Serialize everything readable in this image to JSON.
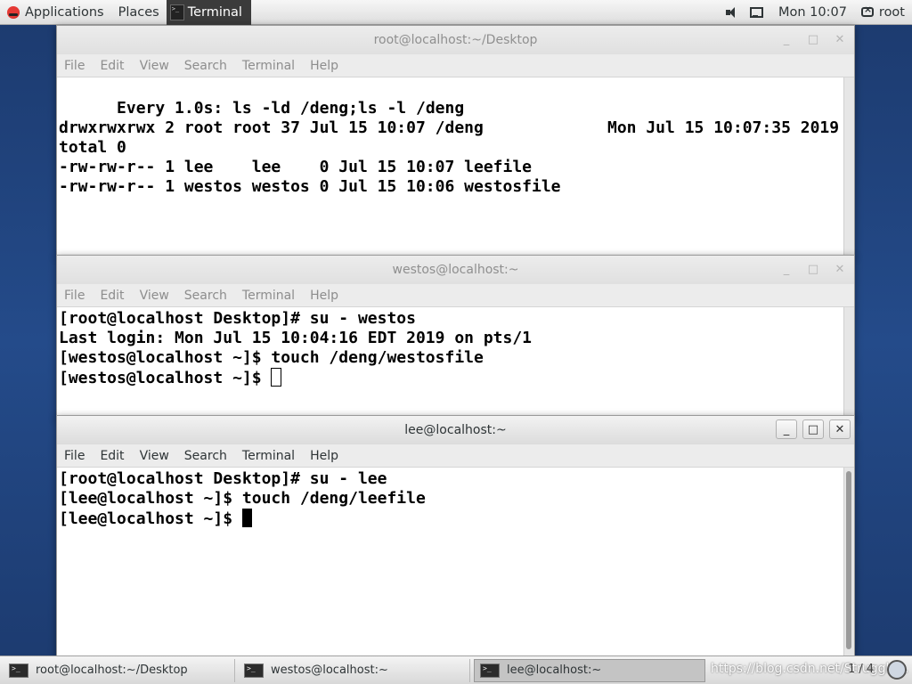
{
  "top_panel": {
    "applications": "Applications",
    "places": "Places",
    "terminal": "Terminal",
    "clock": "Mon 10:07",
    "user": "root"
  },
  "menu": [
    "File",
    "Edit",
    "View",
    "Search",
    "Terminal",
    "Help"
  ],
  "windows": {
    "root": {
      "title": "root@localhost:~/Desktop",
      "watch_header": "Every 1.0s: ls -ld /deng;ls -l /deng",
      "watch_time": "Mon Jul 15 10:07:35 2019",
      "lines": [
        "",
        "drwxrwxrwx 2 root root 37 Jul 15 10:07 /deng",
        "total 0",
        "-rw-rw-r-- 1 lee    lee    0 Jul 15 10:07 leefile",
        "-rw-rw-r-- 1 westos westos 0 Jul 15 10:06 westosfile"
      ]
    },
    "westos": {
      "title": "westos@localhost:~",
      "lines": [
        "[root@localhost Desktop]# su - westos",
        "Last login: Mon Jul 15 10:04:16 EDT 2019 on pts/1",
        "[westos@localhost ~]$ touch /deng/westosfile"
      ],
      "prompt": "[westos@localhost ~]$ "
    },
    "lee": {
      "title": "lee@localhost:~",
      "lines": [
        "[root@localhost Desktop]# su - lee",
        "[lee@localhost ~]$ touch /deng/leefile"
      ],
      "prompt": "[lee@localhost ~]$ "
    }
  },
  "taskbar": {
    "tasks": [
      "root@localhost:~/Desktop",
      "westos@localhost:~",
      "lee@localhost:~"
    ],
    "pager": "1 / 4",
    "watermark": "https://blog.csdn.net/Struggle..."
  },
  "icons": {
    "apps": "redhat-icon",
    "terminal": "terminal-icon",
    "volume": "speaker-icon",
    "network": "network-icon",
    "user": "user-icon"
  }
}
